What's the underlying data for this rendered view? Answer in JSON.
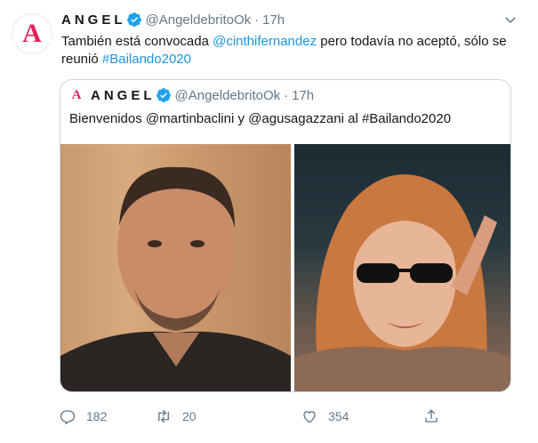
{
  "tweet": {
    "avatar_letter": "A",
    "author_name": "ANGEL",
    "handle": "@AngeldebritoOk",
    "separator": "·",
    "time": "17h",
    "text_part1": "También está convocada ",
    "mention": "@cinthifernandez",
    "text_part2": " pero todavía no aceptó, sólo se reunió ",
    "hashtag": "#Bailando2020"
  },
  "quote": {
    "avatar_letter": "A",
    "author_name": "ANGEL",
    "handle": "@AngeldebritoOk",
    "separator": "·",
    "time": "17h",
    "text": "Bienvenidos @martinbaclini y @agusagazzani al #Bailando2020"
  },
  "actions": {
    "reply_count": "182",
    "retweet_count": "20",
    "like_count": "354"
  },
  "colors": {
    "brand": "#e0245e",
    "link": "#1b95e0",
    "verified": "#1da1f2",
    "muted": "#657786"
  },
  "icons": [
    "verified-badge-icon",
    "chevron-down-icon",
    "reply-icon",
    "retweet-icon",
    "like-icon",
    "share-icon"
  ]
}
